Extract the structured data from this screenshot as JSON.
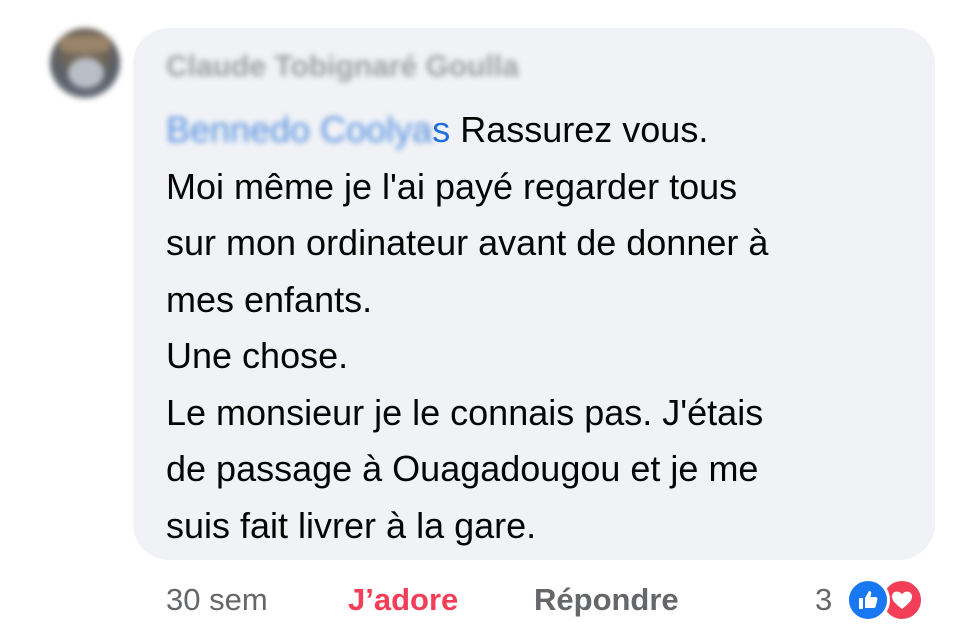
{
  "comment": {
    "author": "Claude Tobignaré Goulla",
    "mention": {
      "blurred": "Bennedo Coolya",
      "visible": "s"
    },
    "lines": [
      "Rassurez vous.",
      "Moi même je l'ai payé regarder tous",
      "sur mon ordinateur avant de donner à",
      "mes enfants.",
      "Une chose.",
      "Le monsieur je le connais pas. J'étais",
      "de passage à Ouagadougou et je me",
      "suis fait livrer à la gare."
    ]
  },
  "footer": {
    "time": "30 sem",
    "react_label": "J’adore",
    "reply_label": "Répondre",
    "reaction_count": "3",
    "reactions": [
      "like-icon",
      "love-icon"
    ]
  },
  "colors": {
    "bubble": "#f0f2f5",
    "mention": "#216fdb",
    "love": "#f33e58",
    "like": "#1877f2",
    "muted": "#65676b"
  }
}
